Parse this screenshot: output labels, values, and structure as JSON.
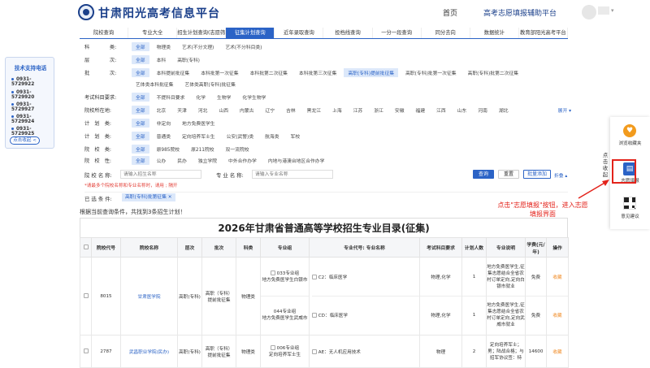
{
  "header": {
    "site_title": "甘肃阳光高考信息平台",
    "nav_home": "首页",
    "nav_assist": "高考志愿填报辅助平台",
    "avatar_caret": "▾"
  },
  "tabs": [
    {
      "label": "院校查询",
      "active": false
    },
    {
      "label": "专业大全",
      "active": false
    },
    {
      "label": "招生计划查询(志愿筛选)",
      "active": false
    },
    {
      "label": "征集计划查询",
      "active": true
    },
    {
      "label": "近年录取查询",
      "active": false
    },
    {
      "label": "投档线查询",
      "active": false
    },
    {
      "label": "一分一段查询",
      "active": false
    },
    {
      "label": "同分去向",
      "active": false
    },
    {
      "label": "数据统计",
      "active": false
    },
    {
      "label": "教育部阳光高考平台",
      "active": false
    }
  ],
  "filters": [
    {
      "label": "科　　　　类:",
      "options": [
        "全部",
        "物理类",
        "艺术(不分文理)",
        "艺术(不分科目类)"
      ]
    },
    {
      "label": "层　　　　次:",
      "options": [
        "全部",
        "本科",
        "高职(专科)"
      ]
    },
    {
      "label": "批　　　　次:",
      "options": [
        "全部",
        "本科提前批征集",
        "本科批第一次征集",
        "本科批第二次征集",
        "本科批第三次征集",
        "高职(专科)提前批征集",
        "高职(专科)批第一次征集",
        "高职(专科)批第二次征集"
      ],
      "options_line2": [
        "艺体类本科批征集",
        "艺体类高职(专科)批征集"
      ]
    },
    {
      "label": "考试科目要求:",
      "options": [
        "全部",
        "不提科目要求",
        "化学",
        "生物学",
        "化学生物学"
      ]
    },
    {
      "label": "院校所在地:",
      "options": [
        "全部",
        "北京",
        "天津",
        "河北",
        "山西",
        "内蒙古",
        "辽宁",
        "吉林",
        "黑龙江",
        "上海",
        "江苏",
        "浙江",
        "安徽",
        "福建",
        "江西",
        "山东",
        "河南",
        "湖北"
      ],
      "collapse": "展开 ▾"
    },
    {
      "label": "计　划　类:",
      "options": [
        "全部",
        "非定向",
        "地方免费医学生"
      ]
    },
    {
      "label": "计　划　类:",
      "options": [
        "全部",
        "普通类",
        "定向培养军士生",
        "公安(武警)类",
        "航海类",
        "军校"
      ]
    },
    {
      "label": "院　校　类:",
      "options": [
        "全部",
        "原985院校",
        "原211院校",
        "双一流院校"
      ]
    },
    {
      "label": "院　校　性:",
      "options": [
        "全部",
        "公办",
        "民办",
        "独立学院",
        "中外合作办学",
        "内地与港澳台地区合作办学"
      ]
    }
  ],
  "search": {
    "school_label": "院 校 名 称:",
    "school_placeholder": "请输入招生名称",
    "major_label": "专 业 名 称:",
    "major_placeholder": "请输入专业名称",
    "query_button": "查询",
    "reset_button": "重置",
    "batch_button": "批量添加",
    "collapse": "折叠 ▴",
    "hint": "*请最多个院校名称和专业名称时，请用 ; 隔开"
  },
  "chosen": {
    "label": "已 选 条 件:",
    "tag": "高职(专科)批第征集 ✕"
  },
  "result_note": "根据当前查询条件，共找到3条招生计划！",
  "table": {
    "title": "2026年甘肃省普通高等学校招生专业目录(征集)",
    "headers": [
      "",
      "院校代号",
      "院校名称",
      "层次",
      "批次",
      "科类",
      "专业组",
      "专业代号: 专业名称",
      "考试科目要求",
      "计划人数",
      "专业说明",
      "学费(元/年)",
      "操作"
    ],
    "rows": [
      {
        "code": "8015",
        "name": "甘肃医学院",
        "level": "高职(专科)",
        "batch": "高职（专科）提前批征集",
        "category": "物理类",
        "majors": [
          {
            "group": "033专业组",
            "group_note": "地方免费医学生白银市",
            "major": "C2：临床医学",
            "subject": "物理,化学",
            "count": "1",
            "desc": "地方免费医学生,征集志愿结合全省农村订单定向,定向白银市就业",
            "fee": "免费"
          },
          {
            "group": "044专业组",
            "group_note": "地方免费医学生武威市",
            "major": "CD：临床医学",
            "subject": "物理,化学",
            "count": "1",
            "desc": "地方免费医学生,征集志愿结合全省农村订单定向,定向武威市就业",
            "fee": "免费"
          }
        ],
        "action": "收藏"
      },
      {
        "code": "2787",
        "name": "武昌职业学院(民办)",
        "level": "高职(专科)",
        "batch": "高职（专科）提前批征集",
        "category": "物理类",
        "majors": [
          {
            "group": "006专业组",
            "group_note": "定向培养军士生",
            "major": "AE：无人机应用技术",
            "subject": "物理",
            "count": "2",
            "desc": "定向培养军士；男；陆战合格；与招军协议签：特",
            "fee": "14600"
          }
        ],
        "action": "收藏"
      }
    ]
  },
  "support": {
    "title": "技术支持电话",
    "phones": [
      "0931-5729922",
      "0931-5729920",
      "0931-5729927",
      "0931-5729924",
      "0931-5729925"
    ],
    "button": "点击收起 <"
  },
  "side_panel": {
    "fav_label": "浏览收藏夹",
    "form_label": "志愿填报",
    "feedback_label": "意见建议",
    "vertical_tab": "点击收起"
  },
  "callout": "点击\"志愿填报\"按钮，进入志愿填报界面",
  "colors": {
    "primary": "#2b63c6",
    "brand": "#1a3f8a",
    "accent_red": "#e3231b",
    "fav_orange": "#f08a24"
  }
}
